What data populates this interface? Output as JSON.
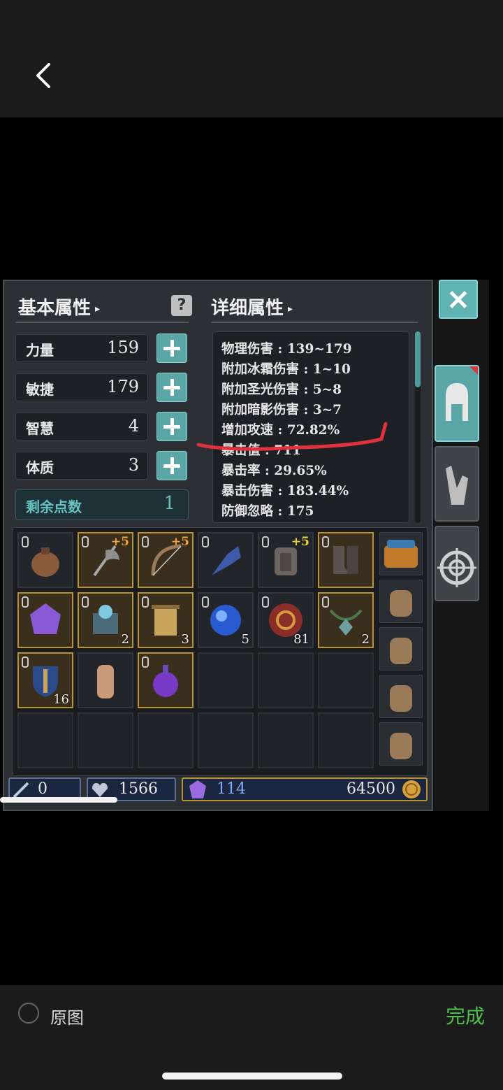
{
  "header": {
    "back_icon": "chevron-left-icon"
  },
  "attributes_panel": {
    "title": "基本属性",
    "caret": "▸",
    "help_glyph": "?",
    "stats": [
      {
        "label": "力量",
        "value": "159"
      },
      {
        "label": "敏捷",
        "value": "179"
      },
      {
        "label": "智慧",
        "value": "4"
      },
      {
        "label": "体质",
        "value": "3"
      }
    ],
    "remaining": {
      "label": "剩余点数",
      "value": "1"
    }
  },
  "details_panel": {
    "title": "详细属性",
    "caret": "▸",
    "lines": [
      "物理伤害 : 139~179",
      "附加冰霜伤害 : 1~10",
      "附加圣光伤害 : 5~8",
      "附加暗影伤害 : 3~7",
      "增加攻速 : 72.82%",
      "暴击值 : 711",
      "暴击率 : 29.65%",
      "暴击伤害 : 183.44%",
      "防御忽略 : 175"
    ],
    "annotation_color": "#e0313d"
  },
  "inventory": {
    "rows": [
      [
        {
          "icon": "coin-pouch-icon",
          "enh": "",
          "qty": ""
        },
        {
          "icon": "battle-axe-icon",
          "enh": "+5",
          "qty": ""
        },
        {
          "icon": "bow-icon",
          "enh": "+5",
          "qty": ""
        },
        {
          "icon": "gauntlet-weapon-icon",
          "enh": "",
          "qty": ""
        },
        {
          "icon": "chest-armor-icon",
          "enh": "+5",
          "qty": ""
        },
        {
          "icon": "boots-icon",
          "enh": "",
          "qty": ""
        }
      ],
      [
        {
          "icon": "purple-gem-icon",
          "enh": "",
          "qty": ""
        },
        {
          "icon": "rune-box-icon",
          "enh": "",
          "qty": "2"
        },
        {
          "icon": "scroll-icon",
          "enh": "",
          "qty": "3"
        },
        {
          "icon": "blue-orb-icon",
          "enh": "",
          "qty": "5"
        },
        {
          "icon": "red-swirl-scroll-icon",
          "enh": "",
          "qty": "81"
        },
        {
          "icon": "amulet-icon",
          "enh": "",
          "qty": "2"
        }
      ],
      [
        {
          "icon": "blue-shield-icon",
          "enh": "",
          "qty": "16"
        },
        {
          "icon": "doll-figure-icon",
          "enh": "",
          "qty": ""
        },
        {
          "icon": "purple-potion-icon",
          "enh": "",
          "qty": ""
        },
        null,
        null,
        null
      ],
      [
        null,
        null,
        null,
        null,
        null,
        null
      ]
    ],
    "bags": [
      "treasure-chest-bag-icon",
      "backpack-icon",
      "backpack-icon",
      "backpack-icon",
      "backpack-icon"
    ]
  },
  "currency": {
    "wand": {
      "icon": "magic-wand-icon",
      "value": "0"
    },
    "hearts": {
      "icon": "heart-gem-icon",
      "value": "1566"
    },
    "crystal": {
      "icon": "purple-crystal-icon",
      "value": "114"
    },
    "gold": {
      "icon": "gold-coin-icon",
      "value": "64500"
    }
  },
  "side_tabs": {
    "close_icon": "close-icon",
    "tabs": [
      "helmet-icon",
      "gloves-icon",
      "target-icon"
    ]
  },
  "bottom_bar": {
    "original_label": "原图",
    "done_label": "完成"
  },
  "colors": {
    "accent_teal": "#5aa6a6",
    "gold_border": "#b8932f",
    "enhance_orange": "#f2a236",
    "done_green": "#4fbf4f"
  }
}
